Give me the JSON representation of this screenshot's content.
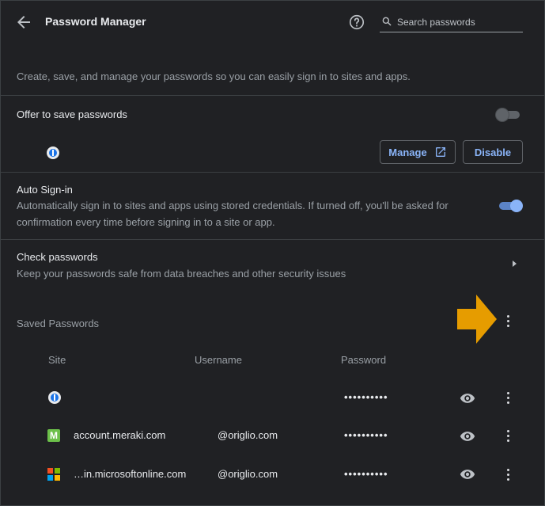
{
  "colors": {
    "background": "#202124",
    "accent": "#8ab4f8",
    "arrow": "#e69c00",
    "divider": "#3c4043"
  },
  "header": {
    "back_icon": "arrow-left-icon",
    "title": "Password Manager",
    "help_icon": "question-circle-icon",
    "search": {
      "placeholder": "Search passwords",
      "value": "",
      "icon": "search-icon"
    }
  },
  "description": "Create, save, and manage your passwords so you can easily sign in to sites and apps.",
  "offer_save": {
    "label": "Offer to save passwords",
    "toggle_on": false,
    "extension_icon": "1password-icon",
    "manage_label": "Manage",
    "manage_icon": "open-in-new-icon",
    "disable_label": "Disable"
  },
  "auto_signin": {
    "label": "Auto Sign-in",
    "desc_line1": "Automatically sign in to sites and apps using stored credentials. If turned off, you'll be asked for",
    "desc_line2": "confirmation every time before signing in to a site or app.",
    "toggle_on": true
  },
  "check_passwords": {
    "label": "Check passwords",
    "desc": "Keep your passwords safe from data breaches and other security issues",
    "chevron_icon": "chevron-right-icon"
  },
  "saved": {
    "title": "Saved Passwords",
    "menu_icon": "more-vert-icon",
    "columns": {
      "site": "Site",
      "username": "Username",
      "password": "Password"
    },
    "rows": [
      {
        "icon": "1password-icon",
        "site": "",
        "username": "",
        "password": "••••••••••"
      },
      {
        "icon": "meraki-icon",
        "icon_letter": "M",
        "site": "account.meraki.com",
        "username": "@origlio.com",
        "password": "••••••••••"
      },
      {
        "icon": "microsoft-icon",
        "site": "…in.microsoftonline.com",
        "username": "@origlio.com",
        "password": "••••••••••"
      }
    ]
  }
}
